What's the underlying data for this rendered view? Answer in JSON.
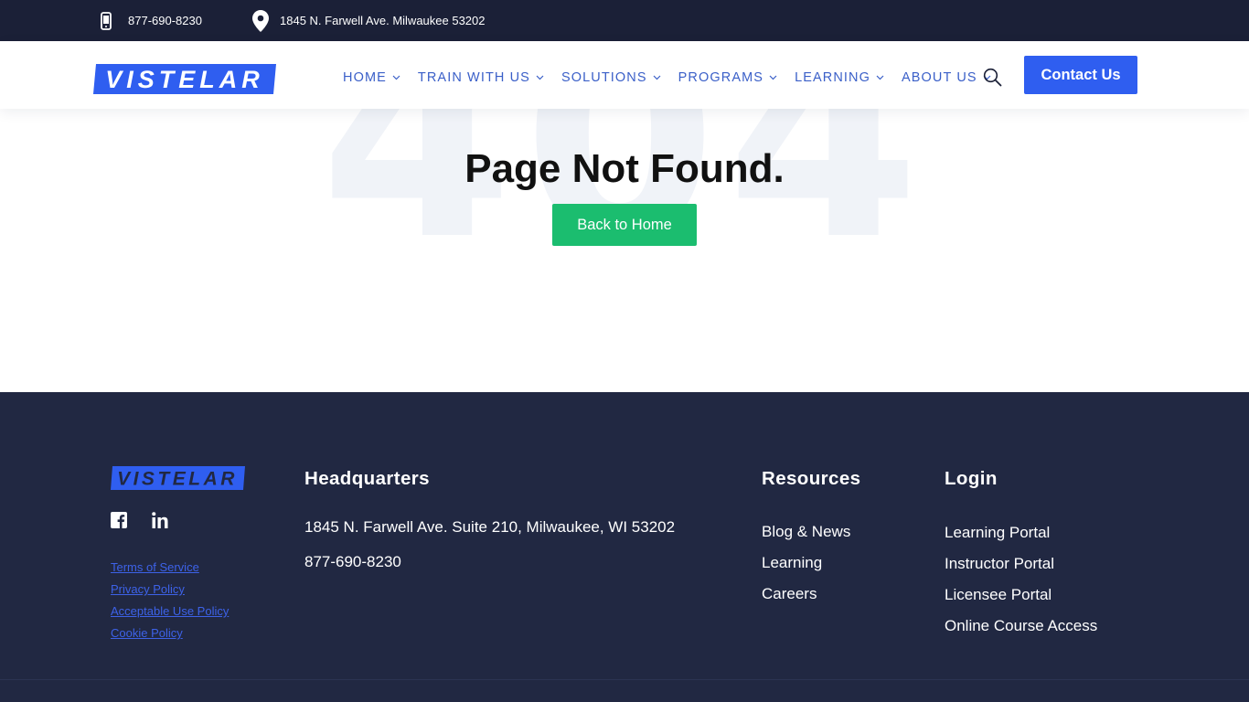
{
  "topbar": {
    "phone": "877-690-8230",
    "address": "1845 N. Farwell Ave. Milwaukee 53202"
  },
  "header": {
    "logo_text": "VISTELAR",
    "nav": [
      "HOME",
      "TRAIN WITH US",
      "SOLUTIONS",
      "PROGRAMS",
      "LEARNING",
      "ABOUT US"
    ],
    "contact_label": "Contact Us"
  },
  "main": {
    "bg_number": "404",
    "title": "Page Not Found.",
    "back_label": "Back to Home"
  },
  "footer": {
    "logo_text": "VISTELAR",
    "legal": [
      "Terms of Service",
      "Privacy Policy",
      "Acceptable Use Policy",
      "Cookie Policy"
    ],
    "hq_title": "Headquarters",
    "hq_address": "1845 N. Farwell Ave. Suite 210, Milwaukee, WI 53202",
    "hq_phone": "877-690-8230",
    "resources_title": "Resources",
    "resources": [
      "Blog & News",
      "Learning",
      "Careers"
    ],
    "login_title": "Login",
    "login": [
      "Learning Portal",
      "Instructor Portal",
      "Licensee Portal",
      "Online Course Access"
    ]
  },
  "colors": {
    "topbar_bg": "#1b2037",
    "nav_text": "#3a5fc8",
    "contact_btn": "#2f5ef0",
    "back_btn": "#1bbd6f",
    "footer_bg": "#212842",
    "legal_link": "#3d62e8"
  },
  "icons": {
    "topbar_phone": "mobile-phone-icon",
    "topbar_address": "map-pin-icon",
    "header_search": "search-icon",
    "nav_dropdown": "chevron-down-icon",
    "social_1": "facebook-icon",
    "social_2": "linkedin-icon"
  }
}
